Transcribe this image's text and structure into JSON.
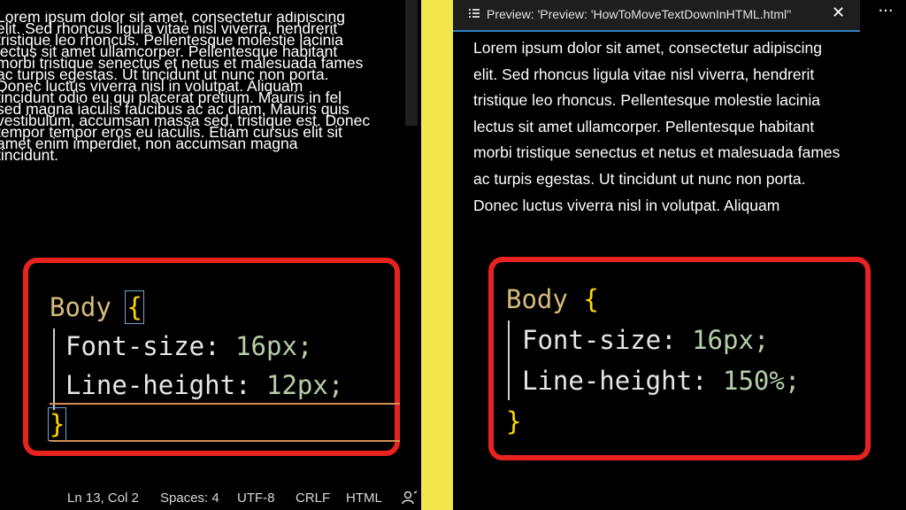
{
  "left": {
    "text_lines": [
      "Lorem ipsum dolor sit amet, consectetur adipiscing",
      "elit. Sed rhoncus ligula vitae nisl viverra, hendrerit",
      "tristique leo rhoncus. Pellentesque molestie lacinia",
      "lectus sit amet ullamcorper. Pellentesque habitant",
      "morbi tristique senectus et netus et malesuada fames",
      "ac turpis egestas. Ut tincidunt ut nunc non porta.",
      "Donec luctus viverra nisl in volutpat. Aliquam",
      "tincidunt odio eu qui placerat pretium. Mauris in fel",
      "sed magna iaculis faucibus ac ac diam, Mauris quis",
      "vestibulum, accumsan massa sed, tristique est. Donec",
      "tempor tempor eros eu iaculis. Etiam cursus elit sit",
      "amet enim imperdiet, non accumsan magna",
      "tincidunt."
    ],
    "code": {
      "selector": "Body",
      "open_brace": "{",
      "close_brace": "}",
      "line1_prop": "Font-size:",
      "line1_val": "16px;",
      "line2_prop": "Line-height:",
      "line2_val": "12px;"
    },
    "status_bar": {
      "position": "Ln 13, Col 2",
      "spaces": "Spaces: 4",
      "encoding": "UTF-8",
      "eol": "CRLF",
      "language": "HTML"
    }
  },
  "right": {
    "tab": {
      "title": "Preview: 'Preview: 'HowToMoveTextDownInHTML.html''",
      "close": "✕"
    },
    "more_actions": "···",
    "text_lines": [
      "Lorem ipsum dolor sit amet, consectetur adipiscing",
      "elit. Sed rhoncus ligula vitae nisl viverra, hendrerit",
      "tristique leo rhoncus. Pellentesque molestie lacinia",
      "lectus sit amet ullamcorper. Pellentesque habitant",
      "morbi tristique senectus et netus et malesuada fames",
      "ac turpis egestas. Ut tincidunt ut nunc non porta.",
      "Donec luctus viverra nisl in volutpat. Aliquam"
    ],
    "code": {
      "selector": "Body",
      "open_brace": "{",
      "close_brace": "}",
      "line1_prop": "Font-size:",
      "line1_val": "16px;",
      "line2_prop": "Line-height:",
      "line2_val": "150%;"
    }
  },
  "colors": {
    "background_divider": "#f2e64a",
    "highlight_border": "#e8231f",
    "selector": "#d7ba7d",
    "brace": "#ffd700",
    "number": "#b5cea8"
  }
}
